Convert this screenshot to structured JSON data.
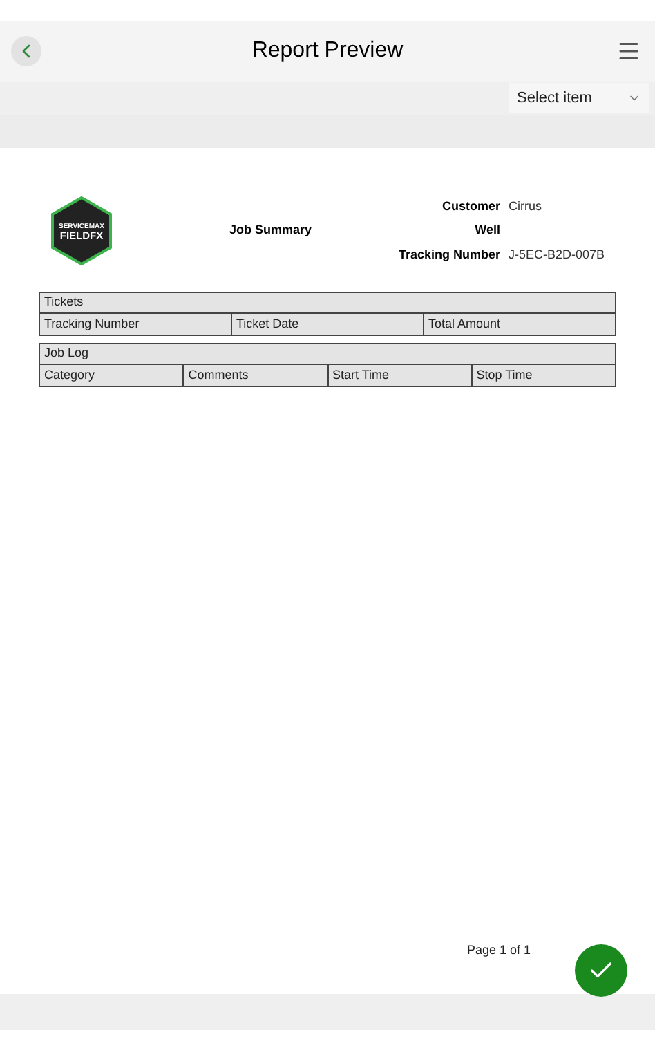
{
  "header": {
    "title": "Report Preview"
  },
  "select": {
    "placeholder": "Select item"
  },
  "report": {
    "logo": {
      "line_1": "SERVICEMAX",
      "line_2": "FIELDFX"
    },
    "title": "Job Summary",
    "fields": [
      {
        "label": "Customer",
        "value": "Cirrus"
      },
      {
        "label": "Well"
      },
      {
        "label": "Tracking Number",
        "value": "J-5EC-B2D-007B"
      }
    ],
    "tables": [
      {
        "title": "Tickets",
        "columns": [
          "Tracking Number",
          "Ticket Date",
          "Total Amount"
        ]
      },
      {
        "title": "Job Log",
        "columns": [
          "Category",
          "Comments",
          "Start Time",
          "Stop Time"
        ]
      }
    ],
    "page_number": "Page 1 of 1"
  }
}
